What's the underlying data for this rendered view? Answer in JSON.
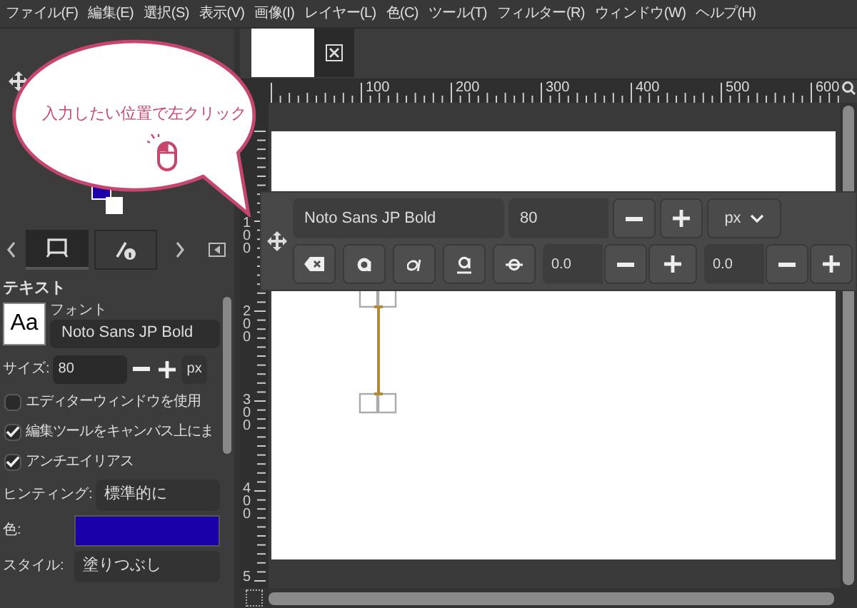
{
  "menu": [
    "ファイル(F)",
    "編集(E)",
    "選択(S)",
    "表示(V)",
    "画像(I)",
    "レイヤー(L)",
    "色(C)",
    "ツール(T)",
    "フィルター(R)",
    "ウィンドウ(W)",
    "ヘルプ(H)"
  ],
  "callout": {
    "text": "入力したい位置で左クリック"
  },
  "dock_tabs": [
    {
      "kind": "device",
      "selected": true
    },
    {
      "kind": "info",
      "selected": false
    }
  ],
  "tool_options": {
    "title": "テキスト",
    "font_preview": "Aa",
    "font_label": "フォント",
    "font": "Noto Sans JP Bold",
    "size_label": "サイズ:",
    "size": "80",
    "unit": "px",
    "checkboxes": [
      {
        "label": "エディターウィンドウを使用",
        "checked": false
      },
      {
        "label": "編集ツールをキャンバス上にま",
        "checked": true
      },
      {
        "label": "アンチエイリアス",
        "checked": true
      }
    ],
    "hinting_label": "ヒンティング:",
    "hinting": "標準的に",
    "color_label": "色:",
    "color": "#1a00a8",
    "style_label": "スタイル:",
    "style": "塗りつぶし"
  },
  "rulers": {
    "horizontal": [
      "100",
      "200",
      "300",
      "400",
      "500",
      "600"
    ],
    "vertical": [
      "100",
      "200",
      "300",
      "400",
      "5"
    ]
  },
  "text_toolbar": {
    "font": "Noto Sans JP Bold",
    "size": "80",
    "unit": "px",
    "baseline": "0.0",
    "kerning": "0.0"
  }
}
